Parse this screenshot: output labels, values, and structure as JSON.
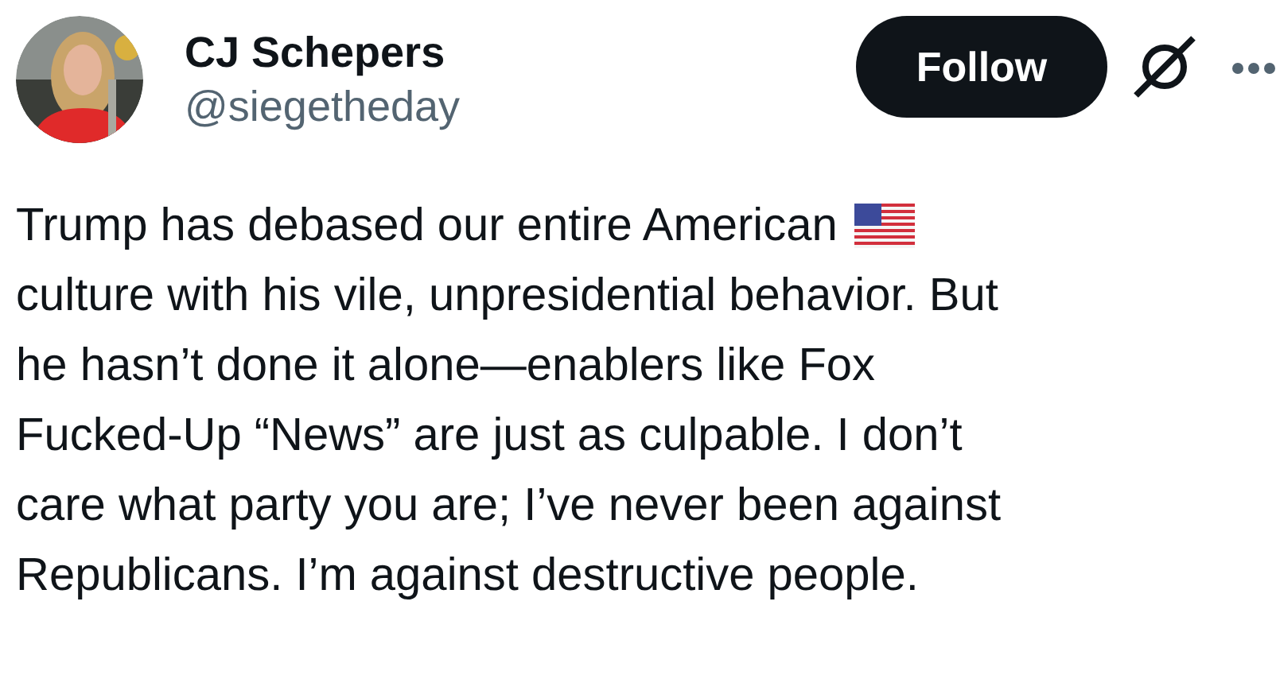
{
  "author": {
    "name": "CJ Schepers",
    "handle": "@siegetheday"
  },
  "follow_button": {
    "label": "Follow"
  },
  "tweet": {
    "lines": [
      {
        "text": "Trump has debased our entire American",
        "kind": "flag"
      },
      {
        "text": "culture with his vile, unpresidential behavior. But",
        "kind": "plain"
      },
      {
        "text": "he hasn’t done it alone—enablers like Fox",
        "kind": "plain"
      },
      {
        "text": "Fucked-Up “News” are just as culpable. I don’t",
        "kind": "plain"
      },
      {
        "text": "care what party you are; I’ve never been against",
        "kind": "plain"
      },
      {
        "text": "Republicans. I’m against destructive people.",
        "kind": "plain"
      }
    ]
  }
}
